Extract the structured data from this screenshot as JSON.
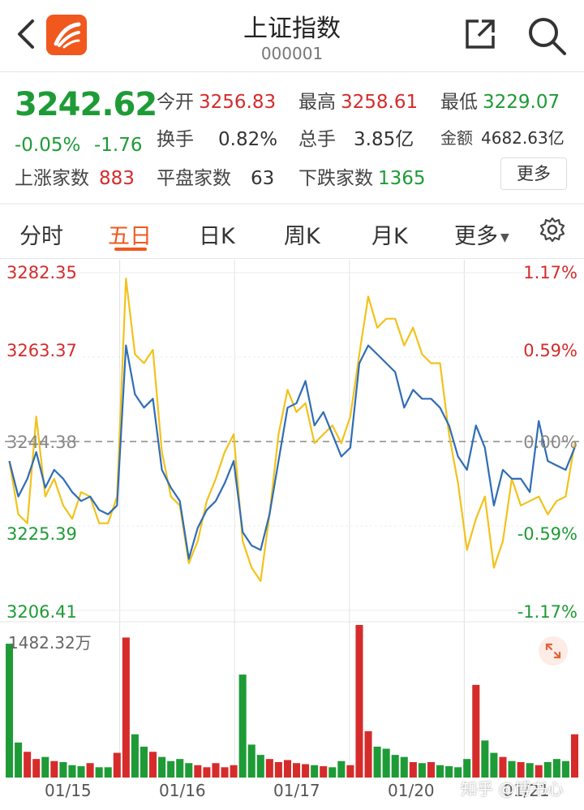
{
  "header": {
    "title": "上证指数",
    "code": "000001"
  },
  "quote": {
    "price": "3242.62",
    "change_pct": "-0.05%",
    "change": "-1.76",
    "open_label": "今开",
    "open": "3256.83",
    "high_label": "最高",
    "high": "3258.61",
    "low_label": "最低",
    "low": "3229.07",
    "turnover_label": "换手",
    "turnover": "0.82%",
    "volume_label": "总手",
    "volume": "3.85亿",
    "amount_label": "金额",
    "amount": "4682.63亿",
    "up_label": "上涨家数",
    "up": "883",
    "flat_label": "平盘家数",
    "flat": "63",
    "down_label": "下跌家数",
    "down": "1365",
    "more_label": "更多"
  },
  "tabs": {
    "items": [
      "分时",
      "五日",
      "日K",
      "周K",
      "月K",
      "更多"
    ],
    "active": "五日"
  },
  "colors": {
    "up": "#d62b2b",
    "down": "#1e9b36",
    "accent": "#f0581e",
    "line_index": "#2f6db5",
    "line_avg": "#f2c21b"
  },
  "chart_data": {
    "type": "line",
    "prev_close": 3244.38,
    "y_ticks_left": [
      "3282.35",
      "3263.37",
      "3244.38",
      "3225.39",
      "3206.41"
    ],
    "y_ticks_right": [
      "1.17%",
      "0.59%",
      "0.00%",
      "-0.59%",
      "-1.17%"
    ],
    "ylim": [
      3206.41,
      3282.35
    ],
    "x_labels": [
      "01/15",
      "01/16",
      "01/17",
      "01/20",
      "01/21"
    ],
    "volume_max_label": "1482.32万",
    "series": [
      {
        "values": [
          3240,
          3232,
          3236,
          3242,
          3234,
          3238,
          3236,
          3233,
          3231,
          3232,
          3229,
          3228,
          3230,
          3266,
          3255,
          3252,
          3254,
          3238,
          3234,
          3231,
          3218,
          3225,
          3229,
          3231,
          3235,
          3240,
          3224,
          3221,
          3220,
          3228,
          3240,
          3252,
          3253,
          3258,
          3248,
          3251,
          3246,
          3241,
          3243,
          3262,
          3266,
          3264,
          3262,
          3260,
          3252,
          3256,
          3254,
          3254,
          3252,
          3248,
          3241,
          3238,
          3248,
          3243,
          3230,
          3238,
          3236,
          3236,
          3233,
          3249,
          3240,
          3239,
          3238,
          3243
        ]
      },
      {
        "values": [
          3240,
          3228,
          3226,
          3250,
          3232,
          3236,
          3230,
          3227,
          3233,
          3232,
          3226,
          3226,
          3232,
          3281,
          3264,
          3262,
          3265,
          3242,
          3232,
          3230,
          3217,
          3222,
          3231,
          3236,
          3242,
          3246,
          3222,
          3216,
          3213,
          3228,
          3246,
          3256,
          3251,
          3253,
          3244,
          3246,
          3248,
          3244,
          3250,
          3264,
          3277,
          3270,
          3272,
          3272,
          3266,
          3270,
          3264,
          3262,
          3262,
          3246,
          3235,
          3220,
          3227,
          3232,
          3216,
          3222,
          3236,
          3230,
          3231,
          3232,
          3228,
          3231,
          3232,
          3244
        ]
      }
    ],
    "volume": [
      1300,
      340,
      250,
      180,
      200,
      160,
      150,
      120,
      110,
      140,
      100,
      100,
      240,
      1360,
      420,
      300,
      250,
      200,
      160,
      180,
      140,
      120,
      100,
      140,
      100,
      120,
      1000,
      320,
      220,
      180,
      150,
      170,
      140,
      130,
      120,
      110,
      100,
      160,
      120,
      1482,
      450,
      300,
      280,
      220,
      200,
      150,
      140,
      150,
      120,
      110,
      100,
      180,
      900,
      360,
      240,
      200,
      160,
      150,
      140,
      120,
      150,
      180,
      160,
      420
    ]
  },
  "watermark": "知乎 @博书心"
}
